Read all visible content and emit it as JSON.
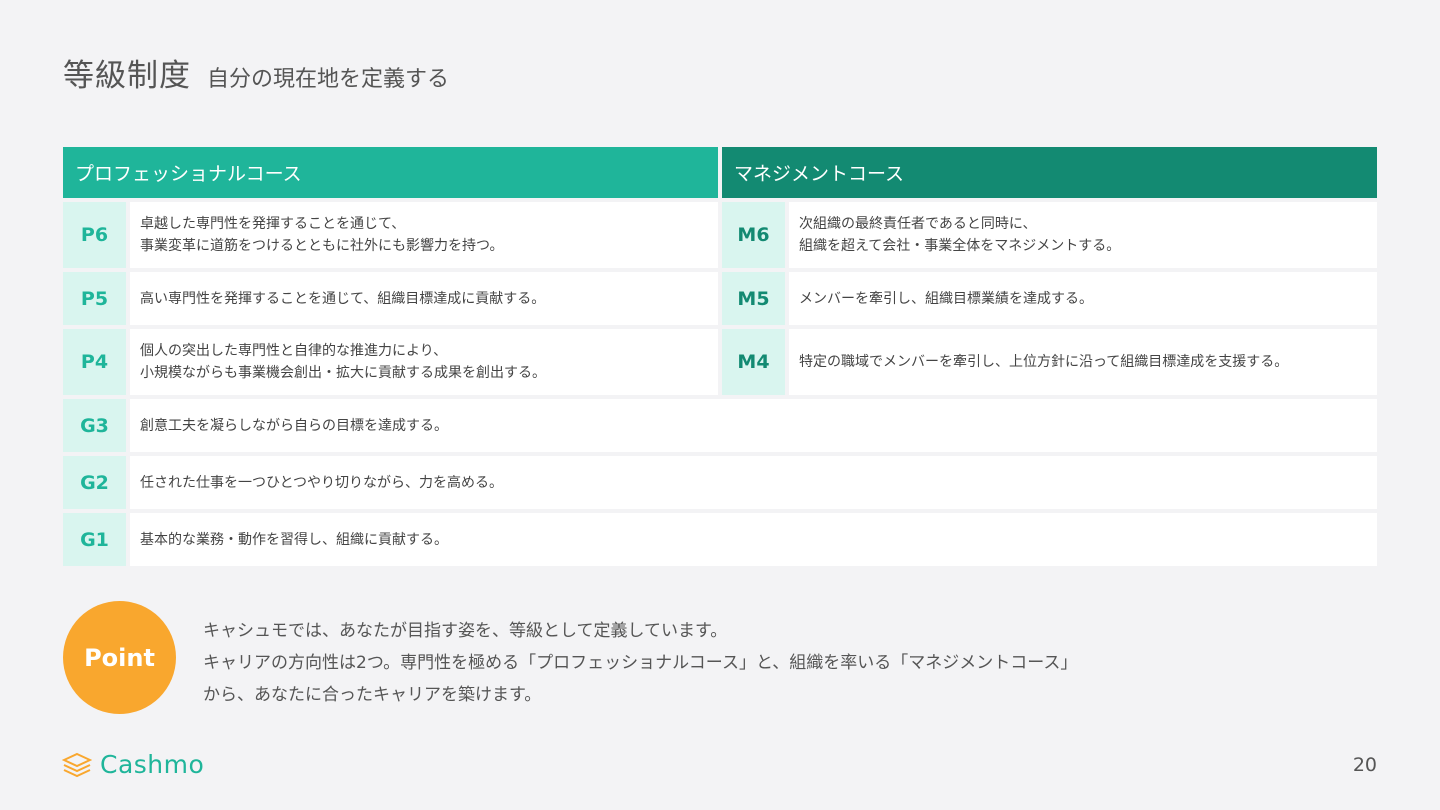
{
  "header": {
    "title": "等級制度",
    "subtitle": "自分の現在地を定義する"
  },
  "courses": {
    "professional": "プロフェッショナルコース",
    "management": "マネジメントコース"
  },
  "pro_rows": [
    {
      "code": "P6",
      "lines": [
        "卓越した専門性を発揮することを通じて、",
        "事業変革に道筋をつけるとともに社外にも影響力を持つ。"
      ]
    },
    {
      "code": "P5",
      "lines": [
        "高い専門性を発揮することを通じて、組織目標達成に貢献する。"
      ]
    },
    {
      "code": "P4",
      "lines": [
        "個人の突出した専門性と自律的な推進力により、",
        "小規模ながらも事業機会創出・拡大に貢献する成果を創出する。"
      ]
    }
  ],
  "mgmt_rows": [
    {
      "code": "M6",
      "lines": [
        "次組織の最終責任者であると同時に、",
        "組織を超えて会社・事業全体をマネジメントする。"
      ]
    },
    {
      "code": "M5",
      "lines": [
        "メンバーを牽引し、組織目標業績を達成する。"
      ]
    },
    {
      "code": "M4",
      "lines": [
        "特定の職域でメンバーを牽引し、上位方針に沿って組織目標達成を支援する。"
      ]
    }
  ],
  "general_rows": [
    {
      "code": "G3",
      "lines": [
        "創意工夫を凝らしながら自らの目標を達成する。"
      ]
    },
    {
      "code": "G2",
      "lines": [
        "任された仕事を一つひとつやり切りながら、力を高める。"
      ]
    },
    {
      "code": "G1",
      "lines": [
        "基本的な業務・動作を習得し、組織に貢献する。"
      ]
    }
  ],
  "point": {
    "badge": "Point",
    "lines": [
      "キャシュモでは、あなたが目指す姿を、等級として定義しています。",
      "キャリアの方向性は2つ。専門性を極める「プロフェッショナルコース」と、組織を率いる「マネジメントコース」",
      "から、あなたに合ったキャリアを築けます。"
    ]
  },
  "footer": {
    "logo_text": "Cashmo",
    "page_number": "20"
  },
  "colors": {
    "pro": "#1fb59a",
    "mgmt": "#138a72",
    "point": "#f9a72e"
  }
}
